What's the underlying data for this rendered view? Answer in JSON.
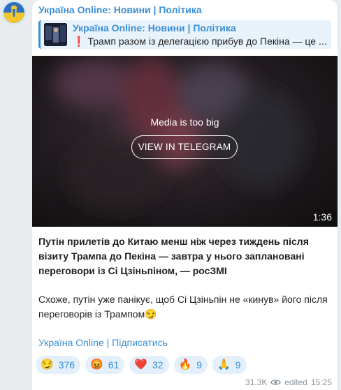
{
  "channel": {
    "name": "Україна Online: Новини | Політика"
  },
  "reply": {
    "title": "Україна Online: Новини | Політика",
    "mark": "❗",
    "text": "Трамп разом із делегацією прибув до Пекіна — це ..."
  },
  "media": {
    "message": "Media is too big",
    "button_label": "VIEW IN TELEGRAM",
    "duration": "1:36"
  },
  "post": {
    "headline": "Путін прилетів до Китаю менш ніж через тиждень після візиту Трампа до Пекіна — завтра у нього заплановані переговори із Сі Цзіньпіном, — росЗМІ",
    "body": "Схоже, путін уже панікує, щоб Сі Цзіньпін не «кинув» його після переговорів із Трампом😏",
    "subscribe_link": "Україна Online | Підписатись"
  },
  "reactions": [
    {
      "emoji": "😏",
      "count": "376"
    },
    {
      "emoji": "😡",
      "count": "61"
    },
    {
      "emoji": "❤️",
      "count": "32"
    },
    {
      "emoji": "🔥",
      "count": "9"
    },
    {
      "emoji": "🙏",
      "count": "9"
    }
  ],
  "footer": {
    "views": "31.3K",
    "edited": "edited",
    "time": "15:25"
  },
  "colors": {
    "accent": "#3a8fd4",
    "reaction_bg": "#e3effa",
    "page_bg": "#e8ecef"
  }
}
